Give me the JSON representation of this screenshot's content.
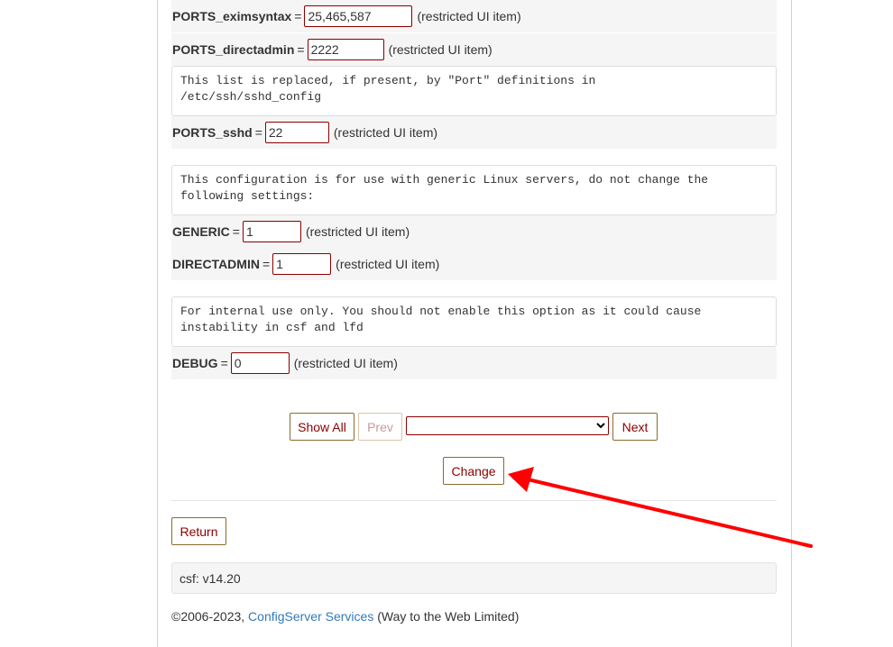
{
  "settings": [
    {
      "name": "PORTS_eximsyntax",
      "value": "25,465,587",
      "note": "(restricted UI item)"
    },
    {
      "name": "PORTS_directadmin",
      "value": "2222",
      "note": "(restricted UI item)"
    },
    {
      "name": "PORTS_sshd",
      "value": "22",
      "note": "(restricted UI item)"
    },
    {
      "name": "GENERIC",
      "value": "1",
      "note": "(restricted UI item)"
    },
    {
      "name": "DIRECTADMIN",
      "value": "1",
      "note": "(restricted UI item)"
    },
    {
      "name": "DEBUG",
      "value": "0",
      "note": "(restricted UI item)"
    }
  ],
  "comments": [
    "This list is replaced, if present, by \"Port\" definitions in\n/etc/ssh/sshd_config",
    "This configuration is for use with generic Linux servers, do not change the\nfollowing settings:",
    "For internal use only. You should not enable this option as it could cause\ninstability in csf and lfd"
  ],
  "nav": {
    "show_all": "Show All",
    "prev": "Prev",
    "next": "Next",
    "page_select_value": ""
  },
  "change_label": "Change",
  "return_label": "Return",
  "version": "csf: v14.20",
  "footer": {
    "copyright": "©2006-2023,",
    "link": "ConfigServer Services",
    "suffix": "(Way to the Web Limited)"
  },
  "colors": {
    "accent": "#8b0000",
    "annotation_arrow": "#ff0000",
    "link": "#337ab7"
  }
}
